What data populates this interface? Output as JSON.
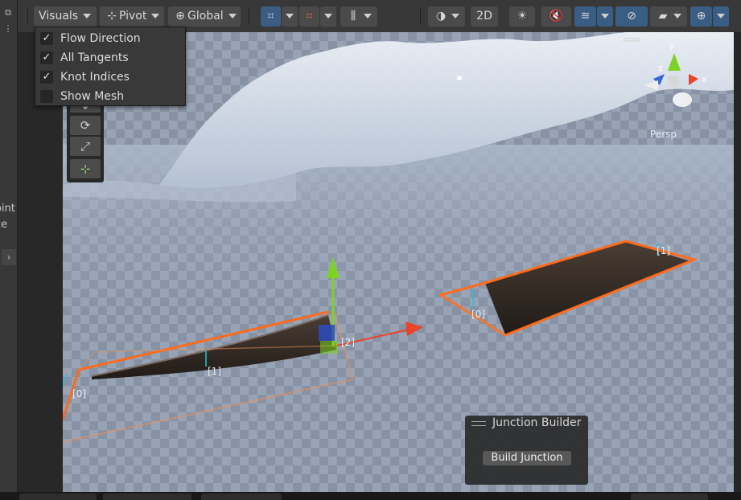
{
  "toolbar": {
    "visuals_label": "Visuals",
    "pivot_label": "Pivot",
    "global_label": "Global",
    "mode_2d_label": "2D"
  },
  "visuals_menu": {
    "items": [
      {
        "label": "Flow Direction",
        "checked": true
      },
      {
        "label": "All Tangents",
        "checked": true
      },
      {
        "label": "Knot Indices",
        "checked": true
      },
      {
        "label": "Show Mesh",
        "checked": false
      }
    ]
  },
  "left_panel": {
    "cut_text_1": "oint",
    "cut_text_2": "ce"
  },
  "gizmo": {
    "y_label": "y",
    "z_label": "z",
    "x_label": "x",
    "projection_label": "Persp"
  },
  "scene_labels": {
    "left_spline_knot_0": "[0]",
    "left_spline_knot_1": "[1]",
    "left_spline_knot_2": "[2]",
    "right_spline_knot_0": "[0]",
    "right_spline_knot_1": "[1]"
  },
  "junction_builder": {
    "title": "Junction Builder",
    "button_label": "Build Junction"
  },
  "colors": {
    "toolbar_bg": "#383838",
    "active_blue": "#3a5d83",
    "spline_orange": "#ff6a1a",
    "axis_green": "#7ed321",
    "axis_red": "#e8442a",
    "sky": "#9aa9bd"
  }
}
